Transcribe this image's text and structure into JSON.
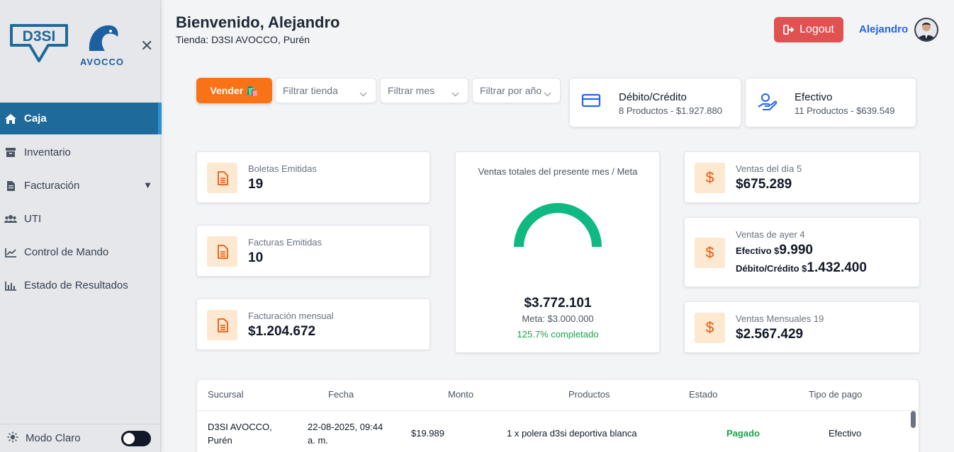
{
  "sidebar": {
    "logo_left_text": "D3SI",
    "logo_right_text": "AVOCCO",
    "close_icon": "close-icon",
    "items": [
      {
        "label": "Caja",
        "icon": "home-icon",
        "active": true
      },
      {
        "label": "Inventario",
        "icon": "box-icon"
      },
      {
        "label": "Facturación",
        "icon": "document-icon",
        "has_caret": true
      },
      {
        "label": "UTI",
        "icon": "users-icon"
      },
      {
        "label": "Control de Mando",
        "icon": "line-chart-icon"
      },
      {
        "label": "Estado de Resultados",
        "icon": "bar-chart-icon"
      }
    ],
    "mode_label": "Modo Claro"
  },
  "header": {
    "welcome": "Bienvenido, Alejandro",
    "store": "Tienda: D3SI AVOCCO, Purén",
    "logout_label": "Logout",
    "username": "Alejandro"
  },
  "toolbar": {
    "vender_label": "Vender 🛍️",
    "filter_store": "Filtrar tienda",
    "filter_month": "Filtrar mes",
    "filter_year": "Filtrar por año"
  },
  "payments": {
    "card": {
      "title": "Débito/Crédito",
      "subtitle": "8 Productos - $1.927.880"
    },
    "cash": {
      "title": "Efectivo",
      "subtitle": "11 Productos - $639.549"
    }
  },
  "stats": {
    "boletas": {
      "label": "Boletas Emitidas",
      "value": "19"
    },
    "facturas": {
      "label": "Facturas Emitidas",
      "value": "10"
    },
    "facturacion": {
      "label": "Facturación mensual",
      "value": "$1.204.672"
    },
    "ventas_dia": {
      "label": "Ventas del día 5",
      "value": "$675.289"
    },
    "ventas_ayer": {
      "label": "Ventas de ayer 4",
      "cash_label": "Efectivo $",
      "cash_value": "9.990",
      "card_label": "Débito/Crédito $",
      "card_value": "1.432.400"
    },
    "ventas_mensuales": {
      "label": "Ventas Mensuales 19",
      "value": "$2.567.429"
    },
    "dollar_symbol": "$"
  },
  "gauge": {
    "title": "Ventas totales del presente mes / Meta",
    "total": "$3.772.101",
    "meta": "Meta: $3.000.000",
    "percent_text": "125.7% completado",
    "percent": 125.7,
    "color": "#10b981"
  },
  "table": {
    "headers": [
      "Sucursal",
      "Fecha",
      "Monto",
      "Productos",
      "Estado",
      "Tipo de pago"
    ],
    "rows": [
      {
        "sucursal_line1": "D3SI AVOCCO,",
        "sucursal_line2": "Purén",
        "fecha_line1": "22-08-2025, 09:44",
        "fecha_line2": "a. m.",
        "monto": "$19.989",
        "productos": "1 x polera d3si deportiva blanca",
        "estado": "Pagado",
        "tipo_pago": "Efectivo"
      }
    ]
  },
  "colors": {
    "primary": "#1e6a9a",
    "orange": "#f97316",
    "logout": "#e05252",
    "success": "#16a34a"
  }
}
